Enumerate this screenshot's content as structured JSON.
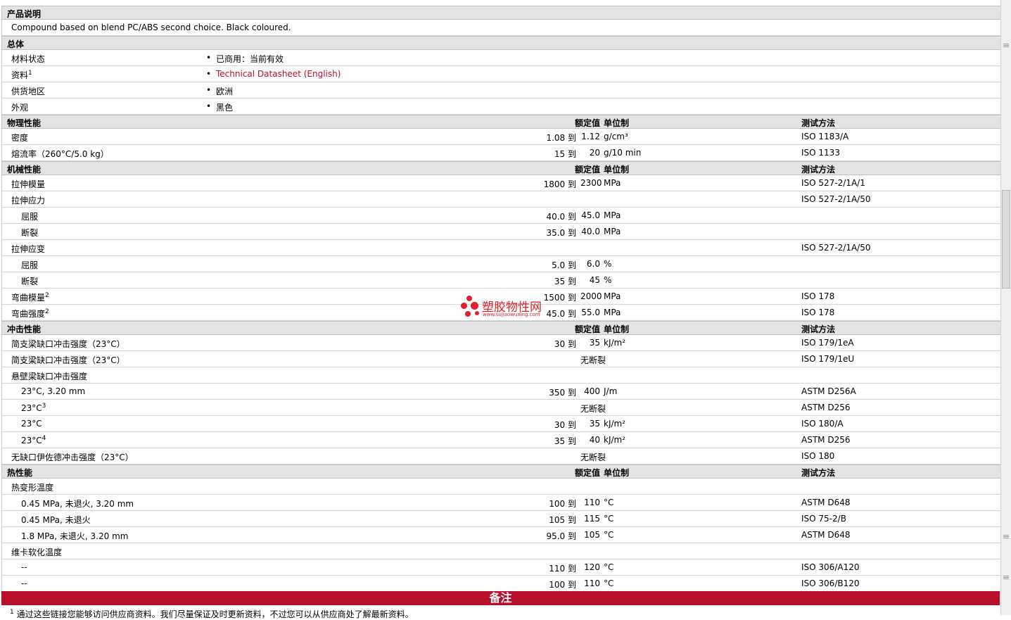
{
  "desc_header": "产品说明",
  "description": "Compound based on blend PC/ABS second choice. Black coloured.",
  "general": {
    "header": "总体",
    "rows": [
      {
        "label": "材料状态",
        "sup": "",
        "value": "已商用：当前有效",
        "link": false
      },
      {
        "label": "资料",
        "sup": "1",
        "value": "Technical Datasheet (English)",
        "link": true
      },
      {
        "label": "供货地区",
        "sup": "",
        "value": "欧洲",
        "link": false
      },
      {
        "label": "外观",
        "sup": "",
        "value": "黑色",
        "link": false
      }
    ]
  },
  "col_headers": {
    "nominal": "额定值",
    "unit": "单位制",
    "method": "测试方法"
  },
  "sections": [
    {
      "title": "物理性能",
      "rows": [
        {
          "label": "密度",
          "sup": "",
          "sub": false,
          "v1": "1.08 到",
          "v2": "1.12",
          "unit": "g/cm³",
          "method": "ISO 1183/A"
        },
        {
          "label": "熔流率（260°C/5.0 kg）",
          "sup": "",
          "sub": false,
          "v1": "15 到",
          "v2": "20",
          "unit": "g/10 min",
          "method": "ISO 1133"
        }
      ]
    },
    {
      "title": "机械性能",
      "rows": [
        {
          "label": "拉伸模量",
          "sup": "",
          "sub": false,
          "v1": "1800 到",
          "v2": "2300",
          "unit": "MPa",
          "method": "ISO 527-2/1A/1"
        },
        {
          "label": "拉伸应力",
          "sup": "",
          "sub": false,
          "v1": "",
          "v2": "",
          "unit": "",
          "method": "ISO 527-2/1A/50"
        },
        {
          "label": "屈服",
          "sup": "",
          "sub": true,
          "v1": "40.0 到",
          "v2": "45.0",
          "unit": "MPa",
          "method": ""
        },
        {
          "label": "断裂",
          "sup": "",
          "sub": true,
          "v1": "35.0 到",
          "v2": "40.0",
          "unit": "MPa",
          "method": ""
        },
        {
          "label": "拉伸应变",
          "sup": "",
          "sub": false,
          "v1": "",
          "v2": "",
          "unit": "",
          "method": "ISO 527-2/1A/50"
        },
        {
          "label": "屈服",
          "sup": "",
          "sub": true,
          "v1": "5.0 到",
          "v2": "6.0",
          "unit": "%",
          "method": ""
        },
        {
          "label": "断裂",
          "sup": "",
          "sub": true,
          "v1": "35 到",
          "v2": "45",
          "unit": "%",
          "method": ""
        },
        {
          "label": "弯曲模量",
          "sup": "2",
          "sub": false,
          "v1": "1500 到",
          "v2": "2000",
          "unit": "MPa",
          "method": "ISO 178"
        },
        {
          "label": "弯曲强度",
          "sup": "2",
          "sub": false,
          "v1": "45.0 到",
          "v2": "55.0",
          "unit": "MPa",
          "method": "ISO 178"
        }
      ]
    },
    {
      "title": "冲击性能",
      "rows": [
        {
          "label": "简支梁缺口冲击强度（23°C）",
          "sup": "",
          "sub": false,
          "v1": "",
          "v2": "无断裂",
          "unit": "kJ/m²",
          "method": "ISO 179/1eA",
          "override": "30 到|35"
        },
        {
          "label": "简支梁缺口冲击强度（23°C）",
          "sup": "",
          "sub": false,
          "v1": "",
          "v2": "无断裂",
          "unit": "",
          "method": "ISO 179/1eU"
        },
        {
          "label": "悬壁梁缺口冲击强度",
          "sup": "",
          "sub": false,
          "v1": "",
          "v2": "",
          "unit": "",
          "method": ""
        },
        {
          "label": "23°C, 3.20 mm",
          "sup": "",
          "sub": true,
          "v1": "350 到",
          "v2": "400",
          "unit": "J/m",
          "method": "ASTM D256A"
        },
        {
          "label": "23°C",
          "sup": "3",
          "sub": true,
          "v1": "",
          "v2": "无断裂",
          "unit": "",
          "method": "ASTM D256"
        },
        {
          "label": "23°C",
          "sup": "",
          "sub": true,
          "v1": "30 到",
          "v2": "35",
          "unit": "kJ/m²",
          "method": "ISO 180/A"
        },
        {
          "label": "23°C",
          "sup": "4",
          "sub": true,
          "v1": "35 到",
          "v2": "40",
          "unit": "kJ/m²",
          "method": "ASTM D256"
        },
        {
          "label": "无缺口伊佐德冲击强度（23°C）",
          "sup": "",
          "sub": false,
          "v1": "",
          "v2": "无断裂",
          "unit": "",
          "method": "ISO 180"
        }
      ]
    },
    {
      "title": "热性能",
      "rows": [
        {
          "label": "热变形温度",
          "sup": "",
          "sub": false,
          "v1": "",
          "v2": "",
          "unit": "",
          "method": ""
        },
        {
          "label": "0.45 MPa, 未退火, 3.20 mm",
          "sup": "",
          "sub": true,
          "v1": "100 到",
          "v2": "110",
          "unit": "°C",
          "method": "ASTM D648"
        },
        {
          "label": "0.45 MPa, 未退火",
          "sup": "",
          "sub": true,
          "v1": "105 到",
          "v2": "115",
          "unit": "°C",
          "method": "ISO 75-2/B"
        },
        {
          "label": "1.8 MPa, 未退火, 3.20 mm",
          "sup": "",
          "sub": true,
          "v1": "95.0 到",
          "v2": "105",
          "unit": "°C",
          "method": "ASTM D648"
        },
        {
          "label": "维卡软化温度",
          "sup": "",
          "sub": false,
          "v1": "",
          "v2": "",
          "unit": "",
          "method": ""
        },
        {
          "label": "--",
          "sup": "",
          "sub": true,
          "v1": "110 到",
          "v2": "120",
          "unit": "°C",
          "method": "ISO 306/A120"
        },
        {
          "label": "--",
          "sup": "",
          "sub": true,
          "v1": "100 到",
          "v2": "110",
          "unit": "°C",
          "method": "ISO 306/B120"
        }
      ]
    }
  ],
  "notes": {
    "header": "备注",
    "first_sup": "1",
    "first_text": "通过这些链接您能够访问供应商资料。我们尽量保证及时更新资料，不过您可以从供应商处了解最新资料。"
  },
  "watermark": {
    "text": "塑胶物性网",
    "url": "www.sujiaowuxing.com"
  }
}
